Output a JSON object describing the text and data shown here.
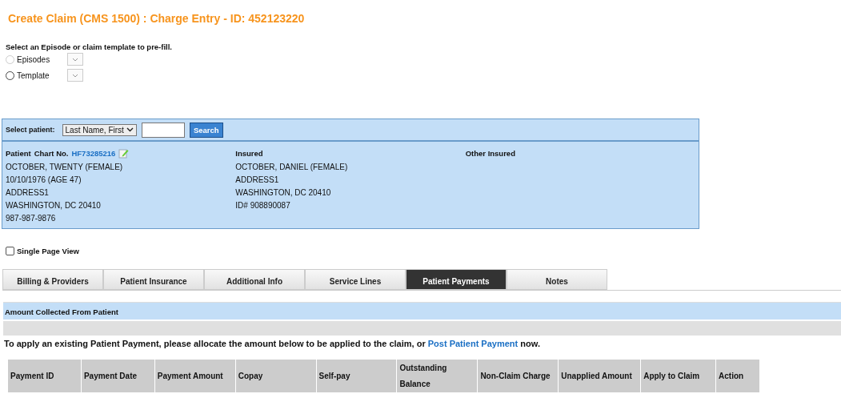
{
  "title": "Create Claim (CMS 1500) : Charge Entry - ID: 452123220",
  "prefill": {
    "prompt": "Select an Episode or claim template to pre-fill.",
    "options": [
      {
        "label": "Episodes",
        "selected": false,
        "disabled": true
      },
      {
        "label": "Template",
        "selected": false,
        "disabled": false
      }
    ]
  },
  "patient_search": {
    "label": "Select patient:",
    "mode": "Last Name, First",
    "button": "Search"
  },
  "patient": {
    "heading": "Patient",
    "chart_label": "Chart No.",
    "chart_no": "HF73285216",
    "lines": [
      "OCTOBER, TWENTY (FEMALE)",
      "10/10/1976 (AGE 47)",
      "ADDRESS1",
      "WASHINGTON, DC 20410"
    ],
    "phone": "987-987-9876"
  },
  "insured": {
    "heading": "Insured",
    "lines": [
      "OCTOBER, DANIEL (FEMALE)",
      "ADDRESS1",
      "WASHINGTON, DC 20410",
      "ID# 908890087"
    ]
  },
  "other_insured": {
    "heading": "Other Insured"
  },
  "single_page_view": {
    "label": "Single Page View",
    "checked": false
  },
  "tabs": [
    {
      "label": "Billing & Providers",
      "selected": false
    },
    {
      "label": "Patient Insurance",
      "selected": false
    },
    {
      "label": "Additional Info",
      "selected": false
    },
    {
      "label": "Service Lines",
      "selected": false
    },
    {
      "label": "Patient Payments",
      "selected": true
    },
    {
      "label": "Notes",
      "selected": false
    }
  ],
  "section_title": "Amount Collected From Patient",
  "instruction": {
    "before": "To apply an existing Patient Payment, please allocate the amount below to be applied to the claim, or ",
    "link": "Post Patient Payment",
    "after": " now."
  },
  "table": {
    "columns": [
      "Payment ID",
      "Payment Date",
      "Payment Amount",
      "Copay",
      "Self-pay",
      "Outstanding Balance",
      "Non-Claim Charge",
      "Unapplied Amount",
      "Apply to Claim",
      "Action"
    ]
  }
}
